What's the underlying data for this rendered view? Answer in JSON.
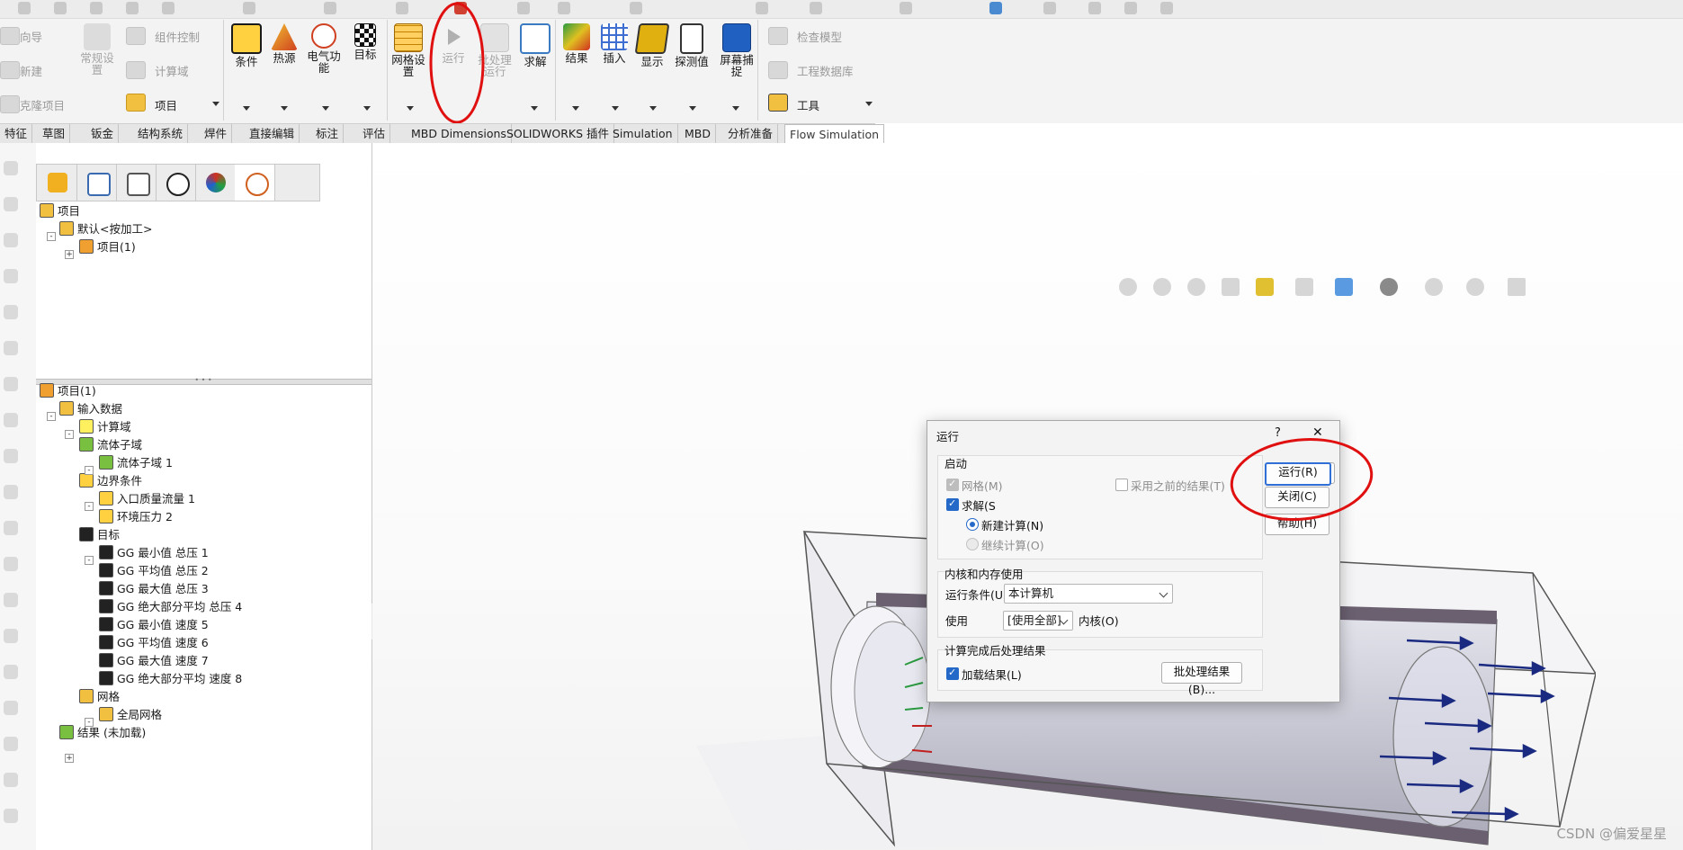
{
  "ribbon": {
    "left_group": {
      "guide": "向导",
      "new": "新建",
      "clone": "克隆项目",
      "general_settings": "常规设\n置",
      "component_control": "组件控制",
      "computational_domain": "计算域",
      "project": "项目"
    },
    "buttons": [
      {
        "label": "条件",
        "color": "#c23b2b"
      },
      {
        "label": "热源",
        "color": "#e0a020"
      },
      {
        "label": "电气功\n能",
        "color": "#d04020"
      },
      {
        "label": "目标",
        "color": "#222222"
      },
      {
        "label": "网格设\n置",
        "color": "#e8b020"
      },
      {
        "label": "运行",
        "color": "#9a9a9a",
        "disabled": true
      },
      {
        "label": "批处理\n运行",
        "color": "#b0b0b0",
        "disabled": true
      },
      {
        "label": "求解",
        "color": "#3a7ac0"
      },
      {
        "label": "结果",
        "color": "#2a9a40"
      },
      {
        "label": "插入",
        "color": "#3d6ed0"
      },
      {
        "label": "显示",
        "color": "#e0b010"
      },
      {
        "label": "探测值",
        "color": "#333333"
      },
      {
        "label": "屏幕捕\n捉",
        "color": "#2060c0"
      }
    ],
    "right_group": {
      "check_model": "检查模型",
      "engineering_db": "工程数据库",
      "tools": "工具"
    }
  },
  "tabs": [
    "特征",
    "草图",
    "钣金",
    "结构系统",
    "焊件",
    "直接编辑",
    "标注",
    "评估",
    "MBD Dimensions",
    "SOLIDWORKS 插件",
    "Simulation",
    "MBD",
    "分析准备",
    "Flow Simulation"
  ],
  "tree_top": [
    {
      "label": "项目",
      "indent": 0
    },
    {
      "label": "默认<按加工>",
      "indent": 1
    },
    {
      "label": "项目(1)",
      "indent": 2
    }
  ],
  "tree_bottom": [
    {
      "label": "项目(1)",
      "indent": 0
    },
    {
      "label": "输入数据",
      "indent": 1
    },
    {
      "label": "计算域",
      "indent": 2
    },
    {
      "label": "流体子域",
      "indent": 2
    },
    {
      "label": "流体子域 1",
      "indent": 3
    },
    {
      "label": "边界条件",
      "indent": 2
    },
    {
      "label": "入口质量流量 1",
      "indent": 3
    },
    {
      "label": "环境压力 2",
      "indent": 3
    },
    {
      "label": "目标",
      "indent": 2
    },
    {
      "label": "GG 最小值 总压 1",
      "indent": 3
    },
    {
      "label": "GG 平均值 总压 2",
      "indent": 3
    },
    {
      "label": "GG 最大值 总压 3",
      "indent": 3
    },
    {
      "label": "GG 绝大部分平均 总压 4",
      "indent": 3
    },
    {
      "label": "GG 最小值 速度 5",
      "indent": 3
    },
    {
      "label": "GG 平均值 速度 6",
      "indent": 3
    },
    {
      "label": "GG 最大值 速度 7",
      "indent": 3
    },
    {
      "label": "GG 绝大部分平均 速度 8",
      "indent": 3
    },
    {
      "label": "网格",
      "indent": 2
    },
    {
      "label": "全局网格",
      "indent": 3
    },
    {
      "label": "结果 (未加载)",
      "indent": 1
    }
  ],
  "dialog": {
    "title": "运行",
    "help_glyph": "?",
    "close_glyph": "✕",
    "startup_group": "启动",
    "mesh": "网格(M)",
    "use_previous": "采用之前的结果(T)",
    "solve": "求解(S",
    "new_calc": "新建计算(N)",
    "continue_calc": "继续计算(O)",
    "cores_group": "内核和内存使用",
    "run_condition_label": "运行条件(U)",
    "run_condition_value": "本计算机",
    "use_label": "使用",
    "use_value": "[使用全部]",
    "cores_suffix": "内核(O)",
    "post_group": "计算完成后处理结果",
    "load_results": "加载结果(L)",
    "batch_results": "批处理结果(B)...",
    "run_button": "运行(R)",
    "close_button": "关闭(C)",
    "help_button": "帮助(H)"
  },
  "watermark": "CSDN @偏爱星星"
}
